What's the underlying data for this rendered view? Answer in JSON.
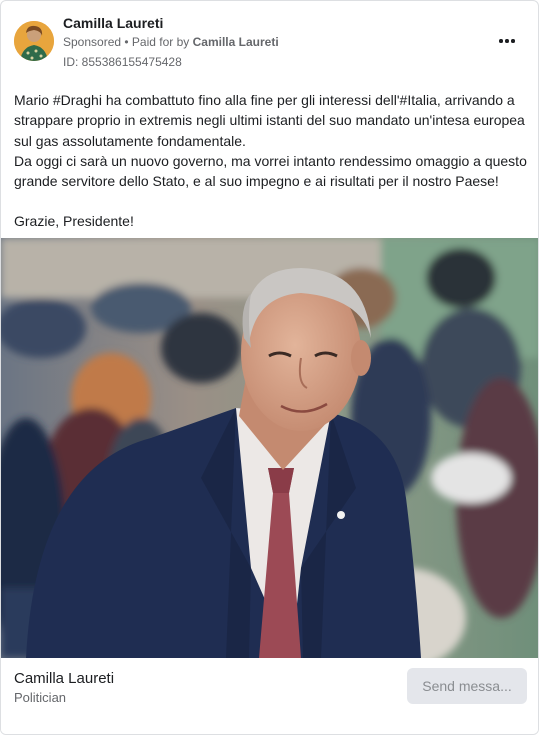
{
  "post": {
    "page_name": "Camilla Laureti",
    "sponsored_label": "Sponsored",
    "separator": " • ",
    "paid_for_prefix": "Paid for by ",
    "paid_for_name": "Camilla Laureti",
    "ad_id": "ID: 855386155475428",
    "paragraphs": [
      "Mario #Draghi ha combattuto fino alla fine per gli interessi dell'#Italia, arrivando a strappare proprio in extremis negli ultimi istanti del suo mandato un'intesa europea sul gas assolutamente fondamentale.",
      "Da oggi ci sarà un nuovo governo, ma vorrei intanto rendessimo omaggio a questo grande servitore dello Stato, e al suo impegno e ai risultati per il nostro Paese!",
      "Grazie, Presidente!"
    ]
  },
  "footer": {
    "name": "Camilla Laureti",
    "category": "Politician",
    "send_button_label": "Send messa..."
  },
  "icons": {
    "more": "more-options-icon",
    "avatar": "profile-avatar"
  },
  "colors": {
    "text_primary": "#1c1e21",
    "text_secondary": "#65676b",
    "button_disabled_bg": "#e4e6eb",
    "button_disabled_text": "#8a8d91",
    "suit": "#1f2d52",
    "tie": "#9c4a55"
  }
}
